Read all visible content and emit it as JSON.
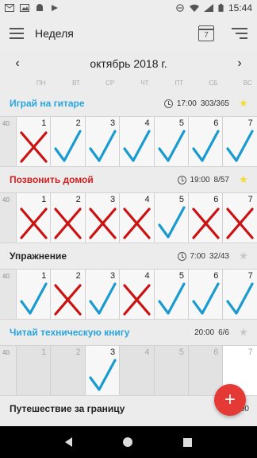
{
  "status_bar": {
    "time": "15:44",
    "left_icons": [
      "gmail-icon",
      "image-icon",
      "android-icon",
      "play-store-icon"
    ],
    "right_icons": [
      "do-not-disturb-icon",
      "wifi-icon",
      "signal-icon",
      "battery-icon"
    ]
  },
  "app_bar": {
    "title": "Неделя",
    "calendar_day": "7"
  },
  "month_nav": {
    "prev": "‹",
    "month": "октябрь 2018 г.",
    "next": "›"
  },
  "weekdays": [
    "ПН",
    "ВТ",
    "СР",
    "ЧТ",
    "ПТ",
    "СБ",
    "ВС"
  ],
  "colors": {
    "blue": "#29a5de",
    "red": "#d21f1f",
    "gray_text": "#222222",
    "check": "#1a9bd0",
    "cross": "#cc1111",
    "star_gold": "#f2dc33",
    "star_gray": "#c6c6c6",
    "fab": "#e53935"
  },
  "habits": [
    {
      "name": "Играй на гитаре",
      "color": "#29a5de",
      "time": "17:00",
      "progress": "303/365",
      "has_alarm": true,
      "starred": true,
      "week_number": "40",
      "days": [
        "1",
        "2",
        "3",
        "4",
        "5",
        "6",
        "7"
      ],
      "marks": [
        "x",
        "check",
        "check",
        "check",
        "check",
        "check",
        "check"
      ]
    },
    {
      "name": "Позвонить домой",
      "color": "#d21f1f",
      "time": "19:00",
      "progress": "8/57",
      "has_alarm": true,
      "starred": true,
      "week_number": "40",
      "days": [
        "1",
        "2",
        "3",
        "4",
        "5",
        "6",
        "7"
      ],
      "marks": [
        "x",
        "x",
        "x",
        "x",
        "check",
        "x",
        "x"
      ]
    },
    {
      "name": "Упражнение",
      "color": "#222222",
      "time": "7:00",
      "progress": "32/43",
      "has_alarm": true,
      "starred": false,
      "week_number": "40",
      "days": [
        "1",
        "2",
        "3",
        "4",
        "5",
        "6",
        "7"
      ],
      "marks": [
        "check",
        "x",
        "check",
        "x",
        "check",
        "check",
        "check"
      ]
    },
    {
      "name": "Читай техническую книгу",
      "color": "#29a5de",
      "time": "20:00",
      "progress": "6/6",
      "has_alarm": false,
      "starred": false,
      "week_number": "40",
      "days": [
        "1",
        "2",
        "3",
        "4",
        "5",
        "6",
        "7"
      ],
      "marks": [
        "",
        "",
        "check",
        "",
        "",
        "",
        ""
      ]
    },
    {
      "name": "Путешествие за границу",
      "color": "#222222",
      "time": "17:00",
      "progress": "",
      "has_alarm": false,
      "starred": false,
      "week_number": "",
      "days": [],
      "marks": []
    }
  ],
  "fab": {
    "label": "+"
  },
  "nav_bar": {
    "buttons": [
      "back",
      "home",
      "recents"
    ]
  }
}
